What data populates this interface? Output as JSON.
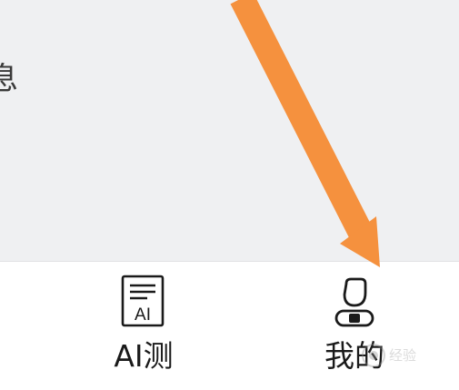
{
  "content": {
    "partial_text": "息"
  },
  "tabs": [
    {
      "label": "AI测",
      "icon": "ai-test-icon",
      "icon_text": "AI"
    },
    {
      "label": "我的",
      "icon": "profile-icon"
    }
  ],
  "watermark": {
    "text": "经验"
  },
  "colors": {
    "arrow": "#f5913e",
    "background": "#eff0f2",
    "tab_bar": "#ffffff",
    "text": "#1a1a1a"
  }
}
